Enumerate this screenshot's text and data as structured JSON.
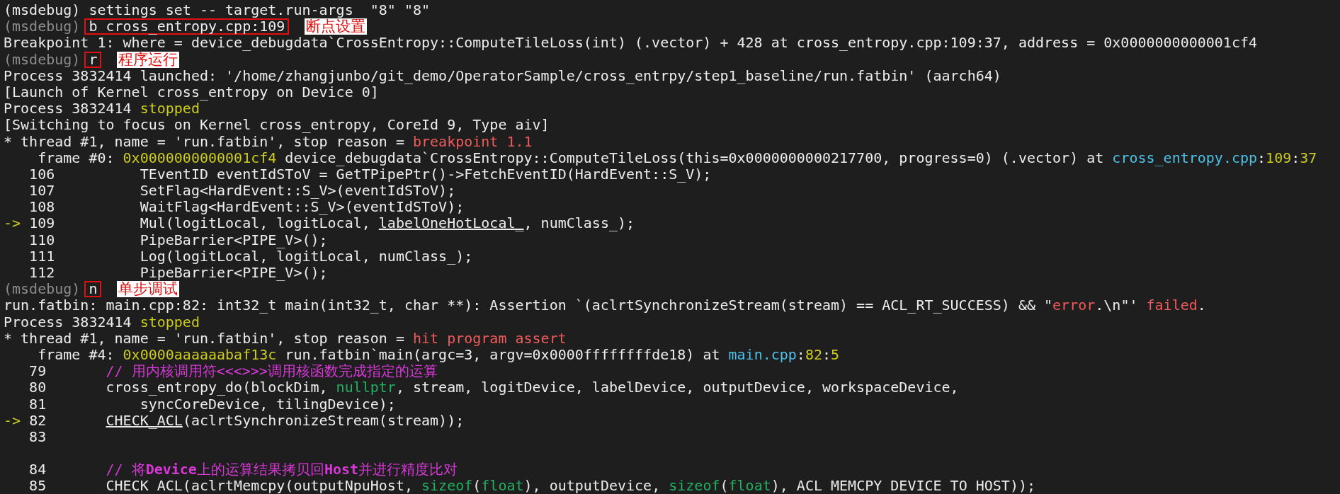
{
  "terminal": {
    "lines": [
      {
        "segments": [
          {
            "text": "(msdebug) settings set -- target.run-args  \"8\" \"8\"",
            "kind": "plain"
          }
        ]
      },
      {
        "segments": [
          {
            "text": "(msdebug) ",
            "kind": "prompt"
          },
          {
            "text": "b cross_entropy.cpp:109",
            "kind": "command"
          }
        ],
        "note": "断点设置"
      },
      {
        "segments": [
          {
            "text": "Breakpoint 1: where = device_debugdata`CrossEntropy::ComputeTileLoss(int) (.vector) + 428 at cross_entropy.cpp:109:37, address = 0x0000000000001cf4",
            "kind": "plain"
          }
        ]
      },
      {
        "segments": [
          {
            "text": "(msdebug) ",
            "kind": "prompt"
          },
          {
            "text": "r",
            "kind": "command"
          }
        ],
        "note": "程序运行"
      },
      {
        "segments": [
          {
            "text": "Process 3832414 launched: '/home/zhangjunbo/git_demo/OperatorSample/cross_entrpy/step1_baseline/run.fatbin' (aarch64)",
            "kind": "plain"
          }
        ]
      },
      {
        "segments": [
          {
            "text": "[Launch of Kernel cross_entropy on Device 0]",
            "kind": "plain"
          }
        ]
      },
      {
        "segments": [
          {
            "text": "Process 3832414 ",
            "kind": "plain"
          },
          {
            "text": "stopped",
            "kind": "status"
          }
        ]
      },
      {
        "segments": [
          {
            "text": "[Switching to focus on Kernel cross_entropy, CoreId 9, Type aiv]",
            "kind": "plain"
          }
        ]
      },
      {
        "segments": [
          {
            "text": "* thread #1, name = 'run.fatbin', stop reason = ",
            "kind": "plain"
          },
          {
            "text": "breakpoint 1.1",
            "kind": "reason"
          }
        ]
      },
      {
        "segments": [
          {
            "text": "    frame #0: ",
            "kind": "plain"
          },
          {
            "text": "0x0000000000001cf4",
            "kind": "address"
          },
          {
            "text": " device_debugdata`CrossEntropy::ComputeTileLoss(this=0x0000000000217700, progress=0) (.vector) at ",
            "kind": "plain"
          },
          {
            "text": "cross_entropy.cpp",
            "kind": "file"
          },
          {
            "text": ":",
            "kind": "plain"
          },
          {
            "text": "109",
            "kind": "number"
          },
          {
            "text": ":",
            "kind": "plain"
          },
          {
            "text": "37",
            "kind": "number"
          }
        ]
      },
      {
        "segments": [
          {
            "text": "   106          TEventID eventIdSToV = GetTPipePtr()->FetchEventID(HardEvent::S_V);",
            "kind": "plain"
          }
        ]
      },
      {
        "segments": [
          {
            "text": "   107          SetFlag<HardEvent::S_V>(eventIdSToV);",
            "kind": "plain"
          }
        ]
      },
      {
        "segments": [
          {
            "text": "   108          WaitFlag<HardEvent::S_V>(eventIdSToV);",
            "kind": "plain"
          }
        ]
      },
      {
        "segments": [
          {
            "text": "->",
            "kind": "arrow"
          },
          {
            "text": " 109          Mul(logitLocal, logitLocal, ",
            "kind": "plain"
          },
          {
            "text": "labelOneHotLocal_",
            "kind": "link"
          },
          {
            "text": ", numClass_);",
            "kind": "plain"
          }
        ]
      },
      {
        "segments": [
          {
            "text": "   110          PipeBarrier<PIPE_V>();",
            "kind": "plain"
          }
        ]
      },
      {
        "segments": [
          {
            "text": "   111          Log(logitLocal, logitLocal, numClass_);",
            "kind": "plain"
          }
        ]
      },
      {
        "segments": [
          {
            "text": "   112          PipeBarrier<PIPE_V>();",
            "kind": "plain"
          }
        ]
      },
      {
        "segments": [
          {
            "text": "(msdebug) ",
            "kind": "prompt"
          },
          {
            "text": "n",
            "kind": "command"
          }
        ],
        "note": "单步调试"
      },
      {
        "segments": [
          {
            "text": "run.fatbin: main.cpp:82: int32_t main(int32_t, char **): Assertion `(aclrtSynchronizeStream(stream) == ACL_RT_SUCCESS) && \"",
            "kind": "plain"
          },
          {
            "text": "error",
            "kind": "reason"
          },
          {
            "text": ".\\n\"' ",
            "kind": "plain"
          },
          {
            "text": "failed",
            "kind": "reason"
          },
          {
            "text": ".",
            "kind": "plain"
          }
        ]
      },
      {
        "segments": [
          {
            "text": "Process 3832414 ",
            "kind": "plain"
          },
          {
            "text": "stopped",
            "kind": "status"
          }
        ]
      },
      {
        "segments": [
          {
            "text": "* thread #1, name = 'run.fatbin', stop reason = ",
            "kind": "plain"
          },
          {
            "text": "hit program assert",
            "kind": "reason"
          }
        ]
      },
      {
        "segments": [
          {
            "text": "    frame #4: ",
            "kind": "plain"
          },
          {
            "text": "0x0000aaaaaabaf13c",
            "kind": "address"
          },
          {
            "text": " run.fatbin`main(argc=3, argv=0x0000ffffffffde18) at ",
            "kind": "plain"
          },
          {
            "text": "main.cpp",
            "kind": "file"
          },
          {
            "text": ":",
            "kind": "plain"
          },
          {
            "text": "82",
            "kind": "number"
          },
          {
            "text": ":",
            "kind": "plain"
          },
          {
            "text": "5",
            "kind": "number"
          }
        ]
      },
      {
        "segments": [
          {
            "text": "   79       ",
            "kind": "plain"
          },
          {
            "text": "// 用内核调用符<<<>>>调用核函数完成指定的运算",
            "kind": "comment"
          }
        ]
      },
      {
        "segments": [
          {
            "text": "   80       cross_entropy_do(blockDim, ",
            "kind": "plain"
          },
          {
            "text": "nullptr",
            "kind": "keyword"
          },
          {
            "text": ", stream, logitDevice, labelDevice, outputDevice, workspaceDevice,",
            "kind": "plain"
          }
        ]
      },
      {
        "segments": [
          {
            "text": "   81           syncCoreDevice, tilingDevice);",
            "kind": "plain"
          }
        ]
      },
      {
        "segments": [
          {
            "text": "->",
            "kind": "arrow"
          },
          {
            "text": " 82       ",
            "kind": "plain"
          },
          {
            "text": "CHECK_ACL",
            "kind": "link"
          },
          {
            "text": "(aclrtSynchronizeStream(stream));",
            "kind": "plain"
          }
        ]
      },
      {
        "segments": [
          {
            "text": "   83",
            "kind": "plain"
          }
        ]
      },
      {
        "kind": "blank"
      },
      {
        "segments": [
          {
            "text": "   84       ",
            "kind": "plain"
          },
          {
            "text": "// 将",
            "kind": "comment"
          },
          {
            "text": "Device",
            "kind": "comment-strong"
          },
          {
            "text": "上的运算结果拷贝回",
            "kind": "comment"
          },
          {
            "text": "Host",
            "kind": "comment-strong"
          },
          {
            "text": "并进行精度比对",
            "kind": "comment"
          }
        ]
      },
      {
        "segments": [
          {
            "text": "   85       CHECK ACL(aclrtMemcpy(outputNpuHost, ",
            "kind": "plain"
          },
          {
            "text": "sizeof",
            "kind": "keyword"
          },
          {
            "text": "(",
            "kind": "plain"
          },
          {
            "text": "float",
            "kind": "keyword"
          },
          {
            "text": "), outputDevice, ",
            "kind": "plain"
          },
          {
            "text": "sizeof",
            "kind": "keyword"
          },
          {
            "text": "(",
            "kind": "plain"
          },
          {
            "text": "float",
            "kind": "keyword"
          },
          {
            "text": "), ACL MEMCPY DEVICE TO HOST));",
            "kind": "plain"
          }
        ]
      }
    ]
  }
}
